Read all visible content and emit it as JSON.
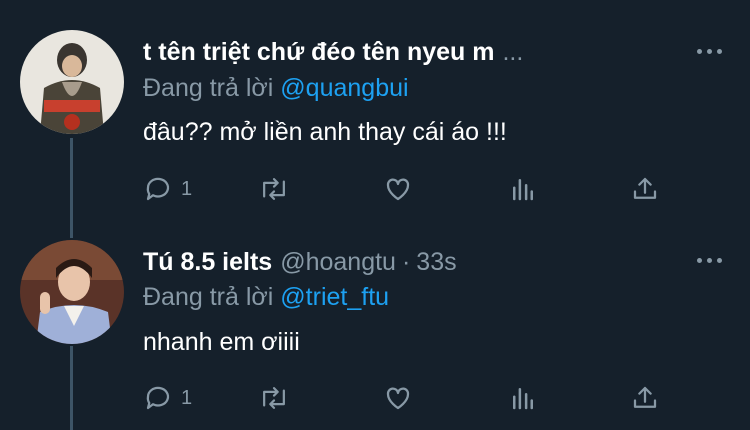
{
  "colors": {
    "background": "#15202b",
    "primary_text": "#ffffff",
    "secondary_text": "#8899a6",
    "link": "#1da1f2",
    "thread_line": "#3d5466"
  },
  "tweets": [
    {
      "display_name": "t tên triệt chứ đéo tên nyeu m",
      "ellipsis": "...",
      "reply_prefix": "Đang trả lời",
      "reply_to": "@quangbui",
      "text": "đâu?? mở liền anh thay cái áo !!!",
      "reply_count": "1",
      "icons": [
        "reply-icon",
        "retweet-icon",
        "like-icon",
        "analytics-icon",
        "share-icon",
        "more-icon"
      ]
    },
    {
      "display_name": "Tú 8.5 ielts",
      "handle": "@hoangtu",
      "separator": "·",
      "time": "33s",
      "reply_prefix": "Đang trả lời",
      "reply_to": "@triet_ftu",
      "text": "nhanh em ơiiii",
      "reply_count": "1",
      "icons": [
        "reply-icon",
        "retweet-icon",
        "like-icon",
        "analytics-icon",
        "share-icon",
        "more-icon"
      ]
    }
  ]
}
